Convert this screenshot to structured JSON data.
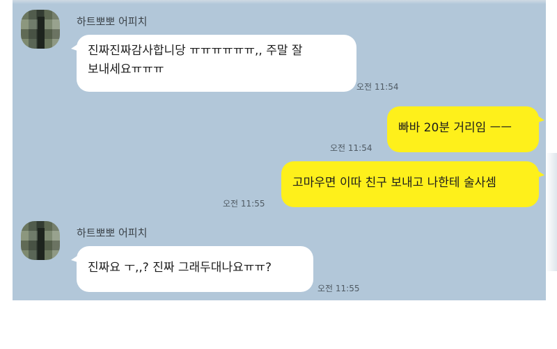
{
  "messages": [
    {
      "sender": "하트뽀뽀 어피치",
      "direction": "incoming",
      "lines": [
        "진짜진짜감사합니당 ㅠㅠㅠㅠㅠㅠ,, 주말 잘",
        "보내세요ㅠㅠㅠ"
      ],
      "time": "오전 11:54"
    },
    {
      "direction": "outgoing",
      "lines": [
        "빠바 20분 거리임 ㅡㅡ"
      ],
      "time": "오전 11:54"
    },
    {
      "direction": "outgoing",
      "lines": [
        "고마우면 이따 친구 보내고 나한테 술사셈"
      ],
      "time": "오전 11:55"
    },
    {
      "sender": "하트뽀뽀 어피치",
      "direction": "incoming",
      "lines": [
        "진짜요 ㅜ,,? 진짜 그래두대나요ㅠㅠ?"
      ],
      "time": "오전 11:55"
    }
  ],
  "colors": {
    "chat_background": "#b2c7d9",
    "incoming_bubble": "#ffffff",
    "outgoing_bubble": "#fef01b"
  }
}
